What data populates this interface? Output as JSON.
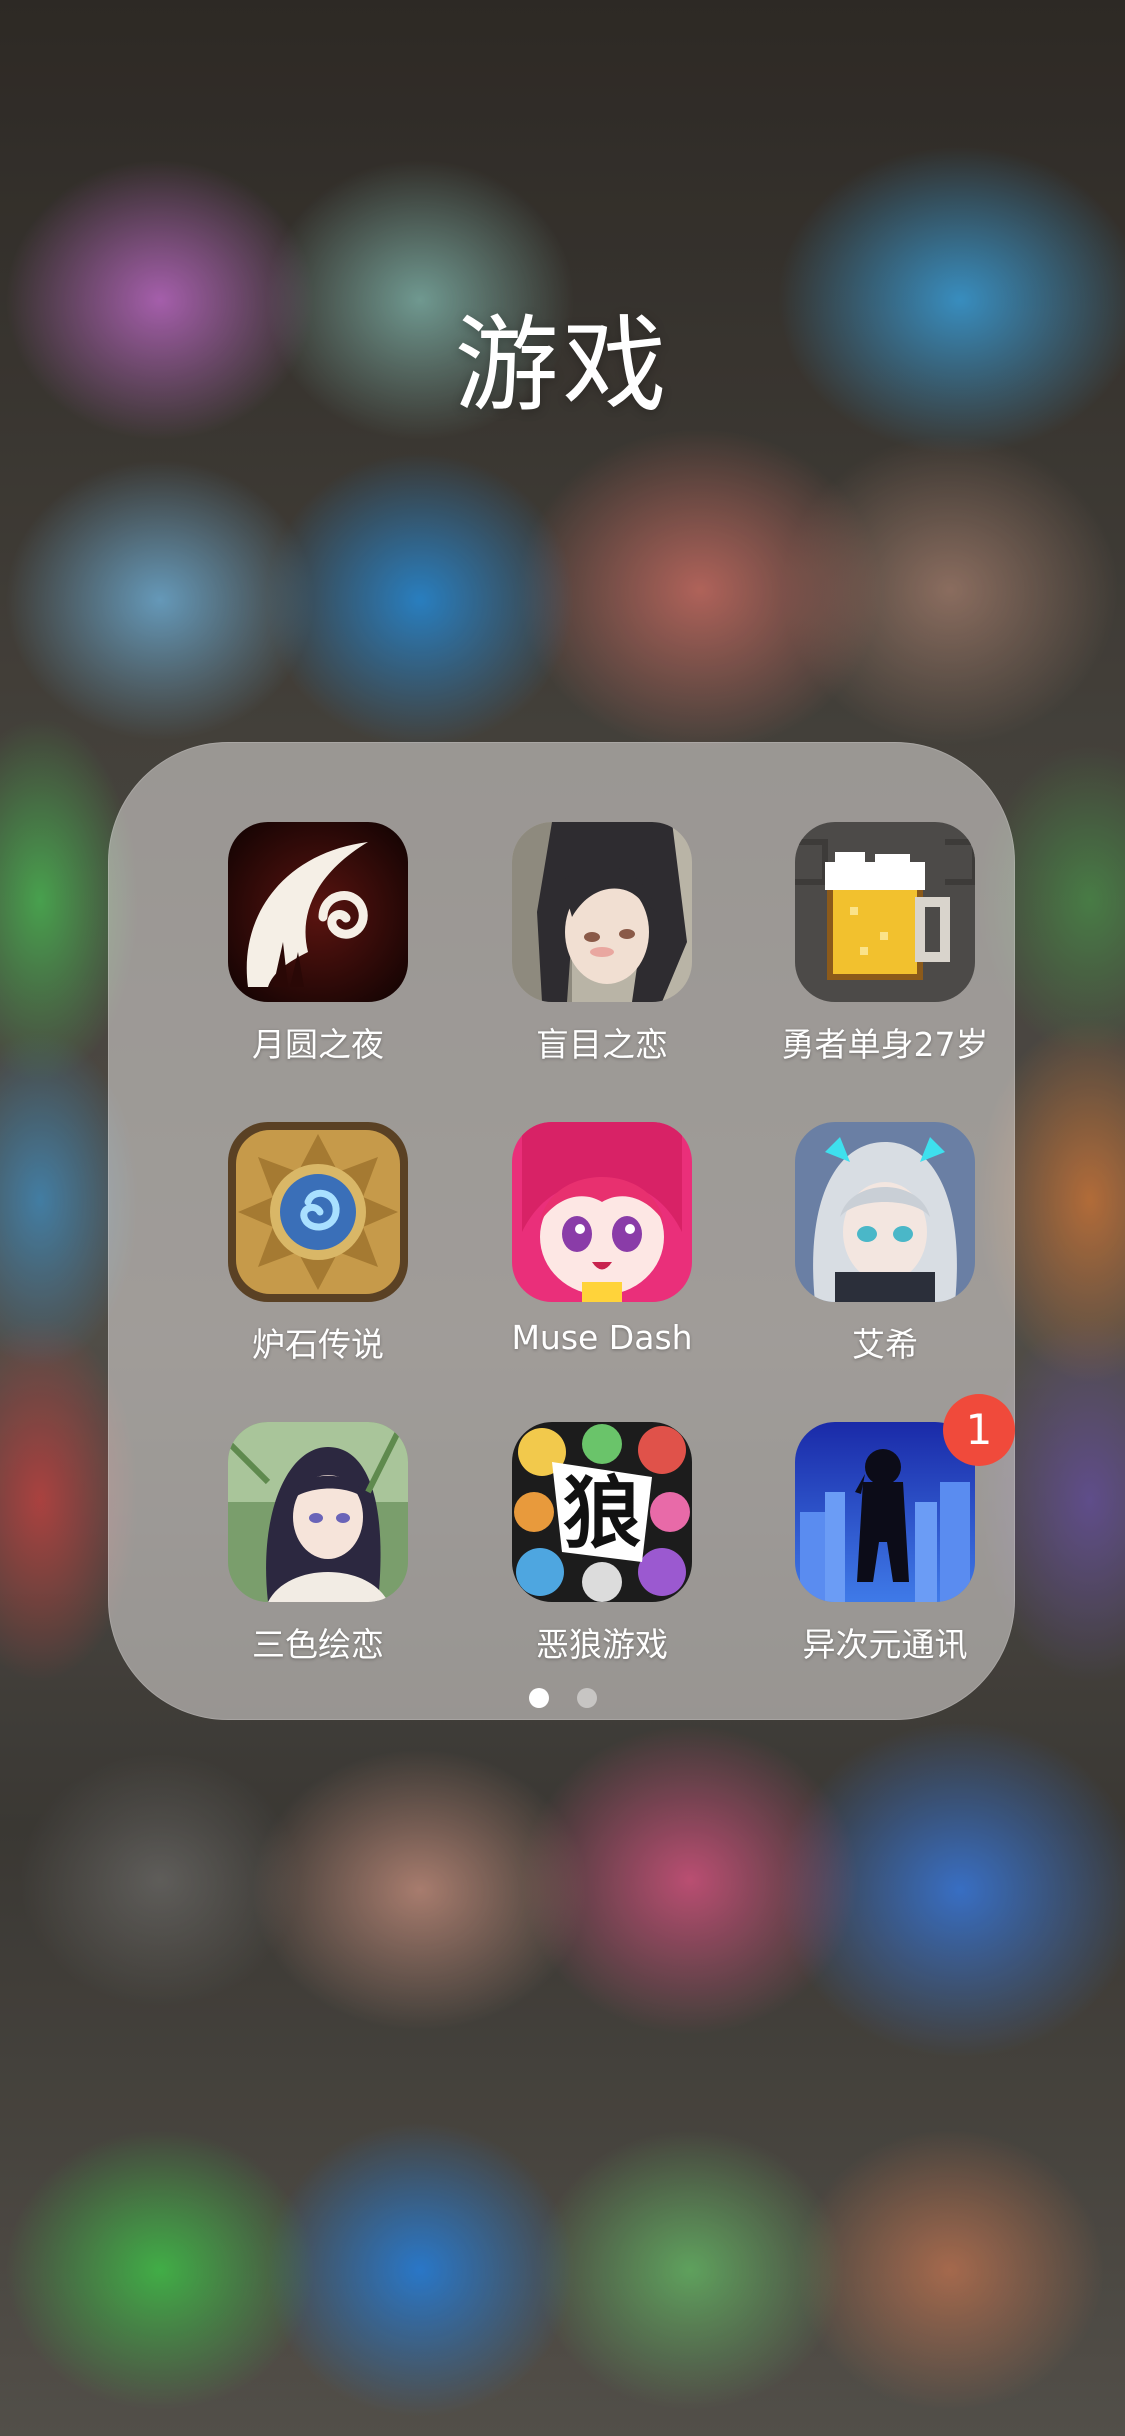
{
  "folder": {
    "title": "游戏"
  },
  "apps": [
    {
      "label": "月圆之夜",
      "icon": "crescent-moon-swirl-icon"
    },
    {
      "label": "盲目之恋",
      "icon": "anime-girl-dark-hair-icon"
    },
    {
      "label": "勇者单身27岁",
      "icon": "pixel-beer-mug-icon"
    },
    {
      "label": "炉石传说",
      "icon": "hearthstone-emblem-icon"
    },
    {
      "label": "Muse Dash",
      "icon": "anime-girl-pink-hair-icon"
    },
    {
      "label": "艾希",
      "icon": "anime-girl-silver-hair-icon"
    },
    {
      "label": "三色绘恋",
      "icon": "anime-girl-forest-icon"
    },
    {
      "label": "恶狼游戏",
      "icon": "wolf-character-collage-icon"
    },
    {
      "label": "异次元通讯",
      "icon": "silhouette-city-night-icon",
      "badge": "1"
    }
  ],
  "pager": {
    "pages": 2,
    "current": 1
  },
  "colors": {
    "badge": "#f04a3b",
    "text": "#ffffff"
  }
}
